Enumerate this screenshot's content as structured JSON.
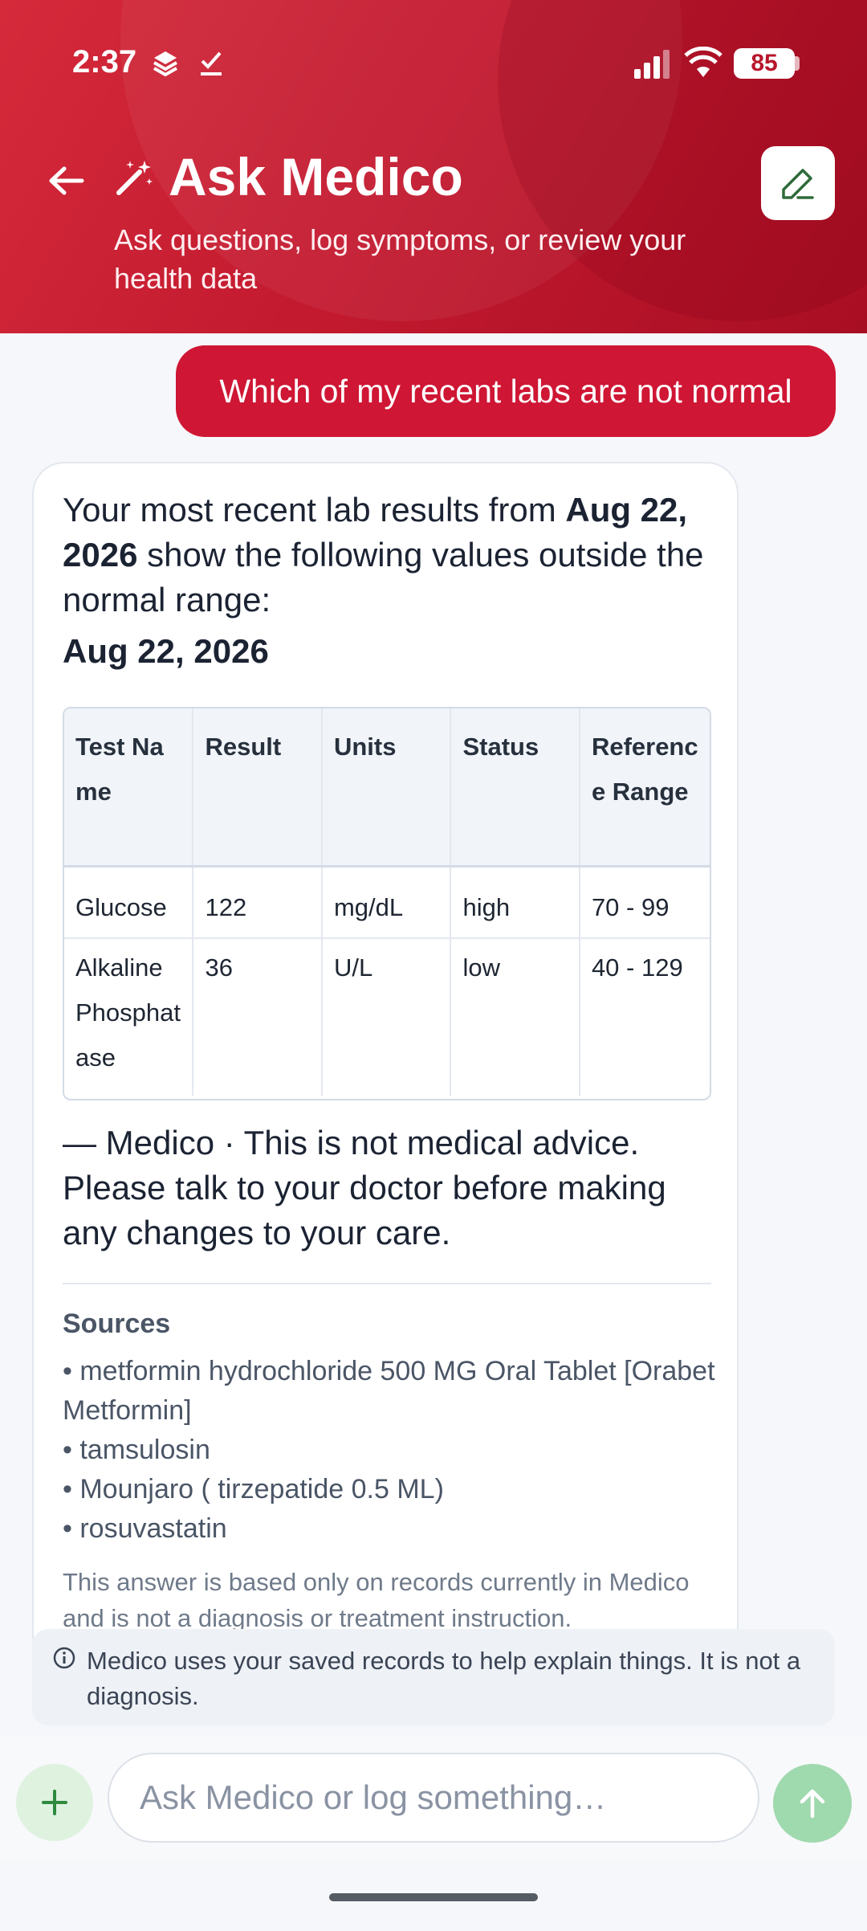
{
  "status_bar": {
    "time": "2:37",
    "battery": "85"
  },
  "header": {
    "title": "Ask Medico",
    "subtitle": "Ask questions, log symptoms, or review your health data"
  },
  "user_message": "Which of my recent labs are not normal",
  "response": {
    "intro_pre": "Your most recent lab results from ",
    "intro_date": "Aug 22, 2026",
    "intro_post": " show the following values outside the normal range:",
    "date_heading": "Aug 22, 2026",
    "table": {
      "headers": [
        "Test Name",
        "Result",
        "Units",
        "Status",
        "Reference Range"
      ],
      "rows": [
        {
          "test": "Glucose",
          "result": "122",
          "units": "mg/dL",
          "status": "high",
          "range": "70 - 99"
        },
        {
          "test": "Alkaline Phosphatase",
          "result": "36",
          "units": "U/L",
          "status": "low",
          "range": "40 - 129"
        }
      ]
    },
    "disclaimer": "— Medico · This is not medical advice. Please talk to your doctor before making any changes to your care.",
    "sources_title": "Sources",
    "sources": [
      "• metformin hydrochloride 500 MG Oral Tablet [Orabet Metformin]",
      "• tamsulosin",
      "• Mounjaro ( tirzepatide 0.5 ML)",
      "• rosuvastatin"
    ],
    "footnote": "This answer is based only on records currently in Medico and is not a diagnosis or treatment instruction."
  },
  "info_banner": "Medico uses your saved records to help explain things. It is not a diagnosis.",
  "composer": {
    "placeholder": "Ask Medico or log something…"
  },
  "colors": {
    "header": "#c41a30",
    "user_bubble": "#cf1634",
    "send_button": "#9fd9ae",
    "add_button_bg": "#dff2e0"
  },
  "icons": [
    "back-arrow-icon",
    "magic-wand-icon",
    "edit-pencil-icon",
    "info-icon",
    "plus-icon",
    "send-arrow-icon",
    "signal-icon",
    "wifi-icon",
    "battery-icon"
  ]
}
